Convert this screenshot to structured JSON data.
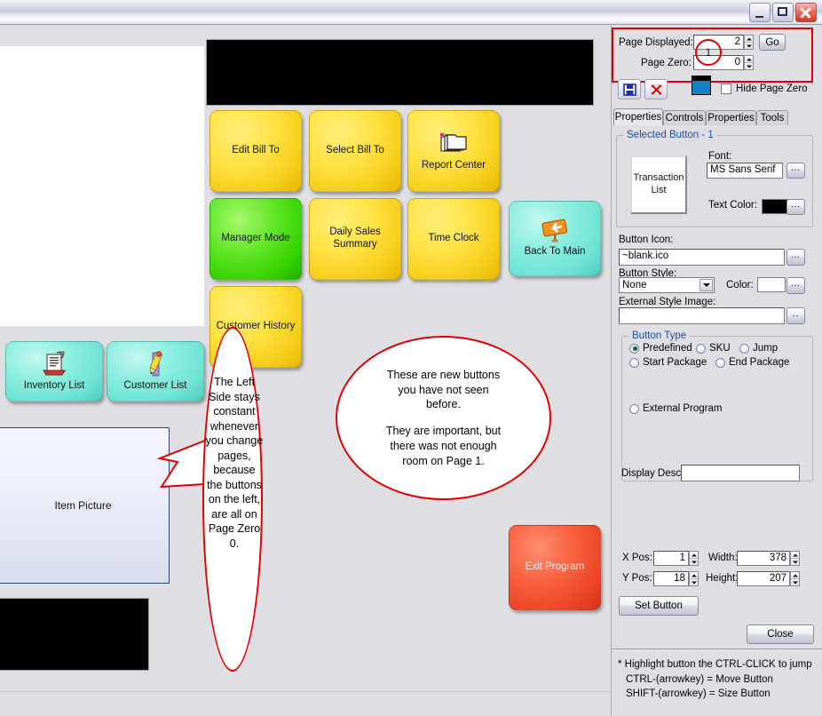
{
  "window": {
    "title": "",
    "buttons": {
      "minimize": "minimize-icon",
      "maximize": "maximize-icon",
      "close": "close-icon"
    }
  },
  "pos": {
    "item_picture_label": "Item Picture",
    "side_buttons": [
      {
        "label": "Inventory List",
        "color": "#8ceede",
        "icon": "inventory-list-icon"
      },
      {
        "label": "Customer List",
        "color": "#8ceede",
        "icon": "pencil-icon"
      }
    ],
    "grid_buttons": [
      {
        "label": "Edit Bill To",
        "color": "#ffe141",
        "icon": ""
      },
      {
        "label": "Select Bill To",
        "color": "#ffe141",
        "icon": ""
      },
      {
        "label": "Report Center",
        "color": "#ffe141",
        "icon": "folders-icon"
      },
      {
        "label": "Manager Mode",
        "color": "#63e62a",
        "icon": ""
      },
      {
        "label": "Daily Sales Summary",
        "color": "#ffe141",
        "icon": ""
      },
      {
        "label": "Time Clock",
        "color": "#ffe141",
        "icon": ""
      },
      {
        "label": "Back To Main",
        "color": "#8ceede",
        "icon": "back-arrow-icon"
      },
      {
        "label": "Customer History",
        "color": "#ffe141",
        "icon": ""
      }
    ],
    "exit_button": {
      "label": "Exit Program",
      "color": "#ec4526"
    }
  },
  "annotations": {
    "marker_1": "1",
    "oval_text": "The Left Side stays constant whenever you change pages, because the buttons on the left, are all on Page Zero 0.",
    "circle_line_1": "These are new buttons",
    "circle_line_2": "you have not seen",
    "circle_line_3": "before.",
    "circle_line_4": "They are important, but",
    "circle_line_5": "there was not enough",
    "circle_line_6": "room on Page 1.",
    "highlight_color": "#e00000"
  },
  "panel": {
    "page_displayed_label": "Page Displayed:",
    "page_displayed_value": "2",
    "page_zero_label": "Page Zero:",
    "page_zero_value": "0",
    "go_label": "Go",
    "save_icon": "save-icon",
    "delete_icon": "delete-icon",
    "color_icon": "color-swatch-icon",
    "hide_page_zero_label": "Hide Page Zero",
    "hide_page_zero_checked": false,
    "tabs": [
      {
        "label": "Properties",
        "selected": true
      },
      {
        "label": "Controls",
        "selected": false
      },
      {
        "label": "Properties",
        "selected": false
      },
      {
        "label": "Tools",
        "selected": false
      }
    ],
    "selected_button": {
      "group_title": "Selected Button - 1",
      "preview_line_1": "Transaction",
      "preview_line_2": "List",
      "font_label": "Font:",
      "font_value": "MS Sans Serif",
      "font_browse": "...",
      "text_color_label": "Text Color:",
      "text_color_value": "#000000",
      "text_color_browse": "..."
    },
    "button_icon_label": "Button Icon:",
    "button_icon_value": "~blank.ico",
    "button_icon_browse": "...",
    "button_style_label": "Button Style:",
    "button_style_value": "None",
    "color_label": "Color:",
    "color_value": "#ffffff",
    "color_browse": "...",
    "external_style_label": "External Style Image:",
    "external_style_value": "",
    "external_style_browse": "..",
    "button_type": {
      "title": "Button Type",
      "options": [
        {
          "label": "Predefined",
          "selected": true
        },
        {
          "label": "SKU",
          "selected": false
        },
        {
          "label": "Jump",
          "selected": false
        },
        {
          "label": "Start Package",
          "selected": false
        },
        {
          "label": "End Package",
          "selected": false
        },
        {
          "label": "External Program",
          "selected": false
        }
      ]
    },
    "display_desc_label": "Display Desc:",
    "display_desc_value": "",
    "xpos_label": "X Pos:",
    "xpos_value": "1",
    "width_label": "Width:",
    "width_value": "378",
    "ypos_label": "Y Pos:",
    "ypos_value": "18",
    "height_label": "Height:",
    "height_value": "207",
    "set_button_label": "Set Button",
    "close_label": "Close",
    "hints": [
      "* Highlight button the CTRL-CLICK to jump",
      "CTRL-(arrowkey) = Move Button",
      "SHIFT-(arrowkey) = Size Button"
    ]
  }
}
